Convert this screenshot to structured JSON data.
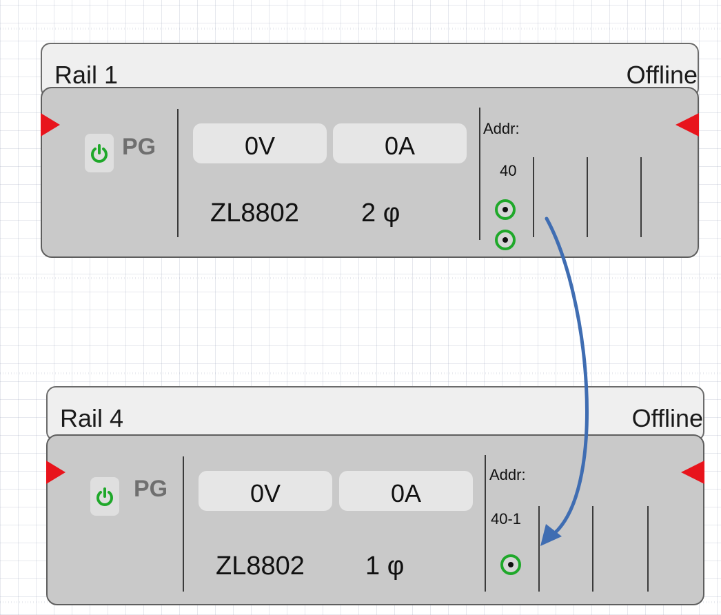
{
  "rails": [
    {
      "title": "Rail 1",
      "status": "Offline",
      "pg": "PG",
      "voltage": "0V",
      "current": "0A",
      "model": "ZL8802",
      "phase": "2 φ",
      "addr_label": "Addr:",
      "addr_value": "40"
    },
    {
      "title": "Rail 4",
      "status": "Offline",
      "pg": "PG",
      "voltage": "0V",
      "current": "0A",
      "model": "ZL8802",
      "phase": "1 φ",
      "addr_label": "Addr:",
      "addr_value": "40-1"
    }
  ],
  "colors": {
    "port": "#e8141c",
    "power_icon": "#1fa82a",
    "arrow": "#3f6db2",
    "panel": "#c9c9c9"
  },
  "icons": {
    "power": "power-icon",
    "port": "triangle-port-icon",
    "phase": "phase-dot-icon"
  }
}
